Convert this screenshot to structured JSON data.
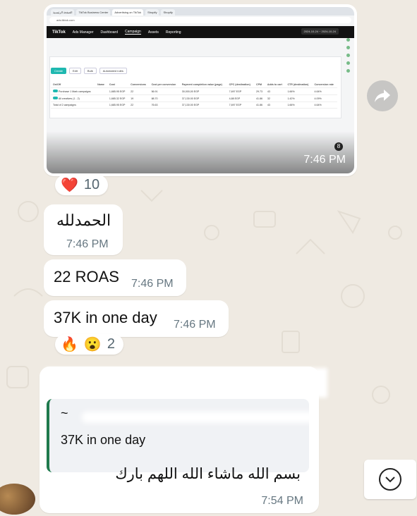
{
  "image_message": {
    "time": "7:46 PM",
    "view_once_icon": "8",
    "screenshot": {
      "tabs": [
        "الصفحة الرئيسية",
        "TikTok Business Center",
        "Advertising on TikTok",
        "Shopify",
        "Shopify"
      ],
      "url": "ads.tiktok.com",
      "app_name": "TikTok",
      "app_sub": "Ads Manager",
      "nav": [
        "Dashboard",
        "Campaign",
        "Assets",
        "Reporting"
      ],
      "date_range": "2024-10-24 ~ 2024-10-24",
      "toolbar": [
        "Create",
        "Edit",
        "Bulk",
        "Automated rules"
      ],
      "columns": [
        "On/Off",
        "Name",
        "Cost",
        "Conversions",
        "Payment completion (Onsite)",
        "Cost per conversion",
        "Payment completion value (page)",
        "CPC (destination)",
        "CPM",
        "Adds to cart",
        "CTR (destination)",
        "Conversion rate"
      ],
      "rows": [
        [
          "Purchase 1 Mark campaigns",
          "1,685.95 EGP",
          "22",
          "56.91",
          "30,000,00 EGP",
          "7,697 EGP",
          "29.73",
          "43",
          "1.66%",
          "4.64%"
        ],
        [
          "All creatives (1 - 2)",
          "1,685.32 EGP",
          "19",
          "88.70",
          "37,130.00 EGP",
          "4,88 EGP",
          "41.86",
          "32",
          "1.42%",
          "4.09%"
        ],
        [
          "Total of 2 campaigns",
          "1,685.95 EGP",
          "22",
          "76.63",
          "37,130.00 EGP",
          "7,697 EGP",
          "41.86",
          "43",
          "1.66%",
          "4.64%"
        ]
      ]
    }
  },
  "reaction_heart": {
    "emoji": "❤️",
    "count": "10"
  },
  "messages": [
    {
      "text": "الحمدلله",
      "time": "7:46 PM"
    },
    {
      "text": "22 ROAS",
      "time": "7:46 PM"
    },
    {
      "text": "37K in one day",
      "time": "7:46 PM"
    }
  ],
  "reaction_fire": {
    "emoji1": "🔥",
    "emoji2": "😮",
    "count": "2"
  },
  "reply_message": {
    "quote_sender": "~",
    "quote_text": "37K in one day",
    "text": "بسم الله ماشاء الله اللهم بارك",
    "time": "7:54 PM"
  },
  "icons": {
    "forward": "forward-icon",
    "scroll": "chevron-down-icon"
  }
}
